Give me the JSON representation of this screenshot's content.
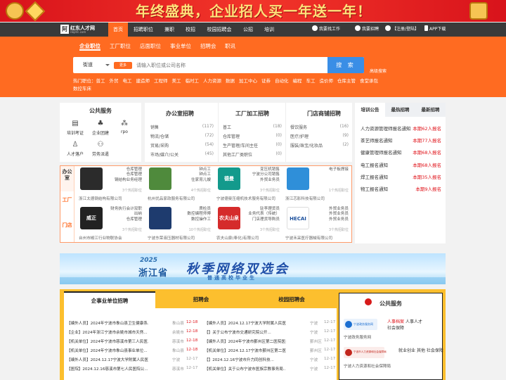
{
  "banner": {
    "slogan": "年终盛典，企业招人买一年送一年！"
  },
  "site": {
    "name": "红东人才网",
    "domain": "nbjdrc.com"
  },
  "nav": {
    "items": [
      "首页",
      "招聘职位",
      "兼职",
      "校招",
      "校园招聘会",
      "公招",
      "培训"
    ]
  },
  "topright": {
    "find_job": "我要找工作",
    "recruit": "我要招聘",
    "login": "【注册/登陆】",
    "app": "APP下载"
  },
  "search": {
    "tabs": [
      "企业职位",
      "工厂职位",
      "店面职位",
      "事业单位",
      "招聘会",
      "职讯"
    ],
    "city": "街道",
    "hot_badge": "更多",
    "placeholder": "请输入职位或公司名称",
    "button": "搜 索",
    "advanced": "高级搜索"
  },
  "hot_jobs": {
    "label": "热门职位：",
    "items": [
      "普工",
      "外贸",
      "电工",
      "建造师",
      "工程师",
      "美工",
      "临时工",
      "人力资源",
      "数据",
      "加工中心",
      "证券",
      "自动化",
      "编程",
      "车工",
      "造价师",
      "仓库主管",
      "食堂承包",
      "数控车床"
    ]
  },
  "public_services": {
    "title": "公共服务",
    "items": [
      "培训考证",
      "企业团建",
      "rpo",
      "人才落户",
      "劳务派遣"
    ],
    "icons": [
      "book-icon",
      "group-icon",
      "network-icon",
      "person-icon",
      "handshake-icon"
    ]
  },
  "categories": [
    {
      "title": "办公室招聘",
      "rows": [
        {
          "label": "销售",
          "count": "(117)"
        },
        {
          "label": "物流/仓储",
          "count": "(72)"
        },
        {
          "label": "贸易/采购",
          "count": "(54)"
        },
        {
          "label": "市场/媒介/公关",
          "count": "(45)"
        }
      ]
    },
    {
      "title": "工厂加工招聘",
      "rows": [
        {
          "label": "普工",
          "count": "(18)"
        },
        {
          "label": "仓库管理",
          "count": "(0)"
        },
        {
          "label": "生产管理/车间主任",
          "count": "(0)"
        },
        {
          "label": "其他工厂类职位",
          "count": "(0)"
        }
      ]
    },
    {
      "title": "门店商铺招聘",
      "rows": [
        {
          "label": "餐饮服务",
          "count": "(16)"
        },
        {
          "label": "医疗/护理",
          "count": "(9)"
        },
        {
          "label": "服装/珠宝/化妆品",
          "count": "(2)"
        },
        {
          "label": "",
          "count": ""
        }
      ]
    }
  ],
  "notices": {
    "tabs": [
      "培训公告",
      "最热招聘",
      "最新招聘"
    ],
    "rows": [
      {
        "title": "人力资源管理师报名通知",
        "status": "本期62人报名"
      },
      {
        "title": "茶艺师报名通知",
        "status": "本期77人报名"
      },
      {
        "title": "健康管理师报名通知",
        "status": "本期68人报名"
      },
      {
        "title": "电工报名通知",
        "status": "本期68人报名"
      },
      {
        "title": "焊工报名通知",
        "status": "本期35人报名"
      },
      {
        "title": "物工报名通知",
        "status": "本期9人报名"
      }
    ]
  },
  "famous": {
    "side_tabs": [
      "办公室",
      "工厂",
      "门店"
    ],
    "companies": [
      {
        "logo": "",
        "logo_color": "#2b2b2b",
        "jobs": [
          "仓库管理",
          "仓库管理",
          "钢结构业务经理"
        ],
        "count": "3个热招职位",
        "name": "浙江太德钢结构有限公司"
      },
      {
        "logo": "",
        "logo_color": "#4f8a3c",
        "jobs": [
          "钟点工",
          "钟点工",
          "住家育儿嫂"
        ],
        "count": "4个热招职位",
        "name": "杭州优品家政服务有限公司"
      },
      {
        "logo": "德曼",
        "logo_color": "#139a8c",
        "jobs": [
          "变压机销售",
          "宁波分公司销售",
          "外贸业务员"
        ],
        "count": "3个热招职位",
        "name": "宁波德曼压缩机技术服务有限公司"
      },
      {
        "logo": "",
        "logo_color": "#2f8fd9",
        "jobs": [
          "电子板焊接"
        ],
        "count": "1个热招职位",
        "name": "浙江芯影科技有限公司"
      },
      {
        "logo": "威正",
        "logo_color": "#222222",
        "jobs": [
          "财务执行会计双职",
          "出纳",
          "仓库管理"
        ],
        "count": "3个热招职位",
        "name": "台州市椒江行业物联协会"
      },
      {
        "logo": "",
        "logo_color": "#1e3b6e",
        "jobs": [
          "质检员",
          "数控编程师傅",
          "数控操作工"
        ],
        "count": "10个热招职位",
        "name": "宁波东荣液压器材有限公司"
      },
      {
        "logo": "农夫山泉",
        "logo_color": "#d52b2b",
        "jobs": [
          "驻李理货员",
          "业务代表（传统）",
          "门店理货导购员"
        ],
        "count": "3个热招职位",
        "name": "农夫山泉(奉化)有限公司"
      },
      {
        "logo": "HECAI",
        "logo_color": "#ffffff",
        "jobs": [
          "外贸业务员",
          "外贸业务员",
          "外贸业务员"
        ],
        "count": "3个热招职位",
        "name": "宁波禾采医疗器械有限公司"
      }
    ]
  },
  "ad": {
    "year": "2025",
    "province": "浙江省",
    "title": "秋季网络双选会",
    "subtitle": "普通高校毕业生"
  },
  "jobfair": {
    "tabs": [
      "企事业单位招聘",
      "招聘会",
      "校园招聘会"
    ],
    "left": [
      {
        "title": "【编外人员】2024年宁波市象山县卫生健康系...",
        "city": "象山县",
        "date": "12-18",
        "hot": true
      },
      {
        "title": "【企业】2024年浙江宁波市余姚市城市天然...",
        "city": "余姚市",
        "date": "12-18",
        "hot": true
      },
      {
        "title": "【机关单位】2024年宁波市慈溪市第三人民医...",
        "city": "慈溪市",
        "date": "12-18",
        "hot": true
      },
      {
        "title": "【机关单位】2024年宁波市象山县事业单位...",
        "city": "象山县",
        "date": "12-18",
        "hot": true
      },
      {
        "title": "【编外人员】2024.12.17宁波大学附属人民医院...",
        "city": "宁波",
        "date": "12-17",
        "hot": false
      },
      {
        "title": "【医院】2024.12.16慈溪市第七人民医院公...",
        "city": "慈溪市",
        "date": "12-17",
        "hot": false
      }
    ],
    "right": [
      {
        "title": "【编外人员】2024.12.17宁波大学附属人民医院...",
        "city": "宁波",
        "date": "12-17",
        "hot": false
      },
      {
        "title": "【】关于公布宁波市交通研究院公开...",
        "city": "宁波",
        "date": "12-17",
        "hot": false
      },
      {
        "title": "【编外人员】2024年宁波市鄞州区第二医院医共...",
        "city": "鄞州区",
        "date": "12-17",
        "hot": false
      },
      {
        "title": "【机关单位】2024.12.17宁波市鄞州区第二医院...",
        "city": "鄞州区",
        "date": "12-17",
        "hot": false
      },
      {
        "title": "【】2024.12.16宁波市升力同创科技...",
        "city": "宁波",
        "date": "12-17",
        "hot": false
      },
      {
        "title": "【机关单位】关于公布宁波市医族宗教事务局...",
        "city": "宁波",
        "date": "12-17",
        "hot": false
      }
    ]
  },
  "public_service": {
    "title": "公共服务",
    "items": [
      {
        "org": "宁波政务服务网",
        "caption": "宁波政务服务网",
        "links": [
          "人事档案",
          "人事人才",
          "社会保障"
        ],
        "logo_color": "#1c6fd1"
      },
      {
        "org": "宁波市人力资源和社会保障局",
        "caption": "宁波人力资源和社会保障局",
        "links": [
          "就业创业",
          "其他",
          "社会保障"
        ],
        "logo_color": "#c2261d"
      }
    ]
  }
}
